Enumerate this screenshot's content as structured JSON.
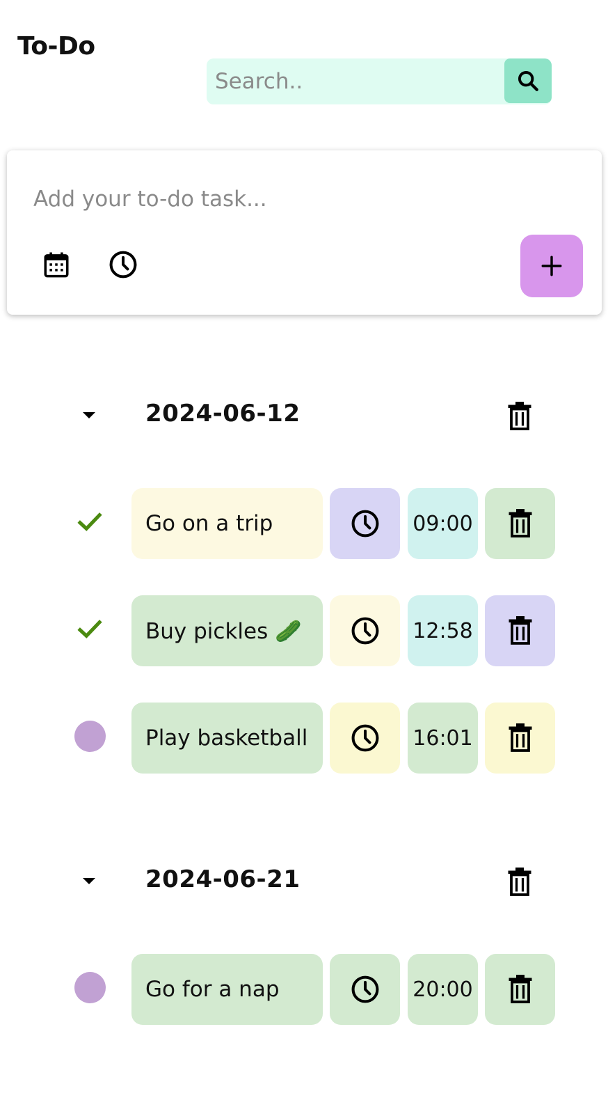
{
  "app": {
    "title": "To-Do"
  },
  "search": {
    "placeholder": "Search.."
  },
  "add_task": {
    "placeholder": "Add your to-do task...",
    "add_label": "+"
  },
  "colors": {
    "search_bg": "#dffcf2",
    "search_button": "#8ee3c7",
    "add_button": "#d896ec",
    "check_green": "#4b8a10",
    "pending_dot": "#c1a1d3",
    "pastel_yellow": "#fdf9e1",
    "pastel_lavender": "#d8d5f5",
    "pastel_cyan": "#d0f2ef",
    "pastel_green": "#d3ead0",
    "pastel_lemon": "#fbf8d1"
  },
  "groups": [
    {
      "date": "2024-06-12",
      "tasks": [
        {
          "text": "Go on a trip",
          "time": "09:00",
          "done": true
        },
        {
          "text": "Buy pickles 🥒",
          "time": "12:58",
          "done": true
        },
        {
          "text": "Play basketball",
          "time": "16:01",
          "done": false
        }
      ]
    },
    {
      "date": "2024-06-21",
      "tasks": [
        {
          "text": "Go for a nap",
          "time": "20:00",
          "done": false
        }
      ]
    }
  ],
  "icons": {
    "search": "search-icon",
    "calendar": "calendar-icon",
    "clock": "clock-icon",
    "add": "plus-icon",
    "collapse": "caret-down-icon",
    "delete": "trash-icon",
    "done": "checkmark-icon"
  }
}
